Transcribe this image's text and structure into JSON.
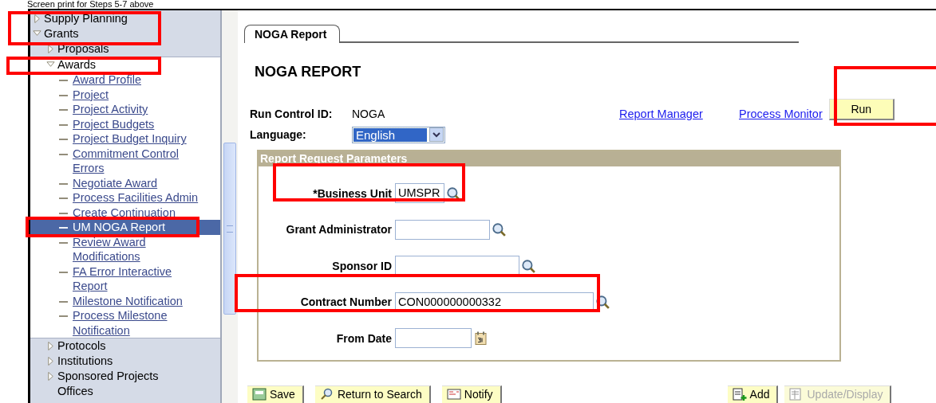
{
  "caption": "Screen print for Steps 5-7 above",
  "nav": [
    {
      "label": "Supply Planning",
      "expanded": false
    },
    {
      "label": "Grants",
      "expanded": true,
      "children": [
        {
          "label": "Proposals",
          "expanded": false
        },
        {
          "label": "Awards",
          "expanded": true,
          "children": [
            {
              "label": "Award Profile",
              "selected": false
            },
            {
              "label": "Project",
              "selected": false
            },
            {
              "label": "Project Activity",
              "selected": false
            },
            {
              "label": "Project Budgets",
              "selected": false
            },
            {
              "label": "Project Budget Inquiry",
              "selected": false
            },
            {
              "label": "Commitment Control Errors",
              "selected": false
            },
            {
              "label": "Negotiate Award",
              "selected": false
            },
            {
              "label": "Process Facilities Admin",
              "selected": false
            },
            {
              "label": "Create Continuation",
              "selected": false
            },
            {
              "label": "UM NOGA Report",
              "selected": true
            },
            {
              "label": "Review Award Modifications",
              "selected": false
            },
            {
              "label": "FA Error Interactive Report",
              "selected": false
            },
            {
              "label": "Milestone Notification",
              "selected": false
            },
            {
              "label": "Process Milestone Notification",
              "selected": false
            }
          ]
        },
        {
          "label": "Protocols",
          "expanded": false
        },
        {
          "label": "Institutions",
          "expanded": false
        },
        {
          "label": "Sponsored Projects Offices",
          "expanded": false
        }
      ]
    }
  ],
  "tabs": [
    {
      "label": "NOGA Report",
      "selected": true
    }
  ],
  "page_title": "NOGA REPORT",
  "run_control": {
    "label": "Run Control ID:",
    "value": "NOGA"
  },
  "links": [
    "Report Manager",
    "Process Monitor"
  ],
  "run_button": "Run",
  "language": {
    "label": "Language:",
    "value": "English"
  },
  "group": {
    "title": "Report Request Parameters",
    "fields": [
      {
        "label": "*Business Unit",
        "value": "UMSPR",
        "kind": "lookup"
      },
      {
        "label": "Grant Administrator",
        "kind": "lookup"
      },
      {
        "label": "Sponsor ID",
        "kind": "lookup"
      },
      {
        "label": "Contract Number",
        "value": "CON000000000332",
        "kind": "lookup"
      },
      {
        "label": "From Date",
        "kind": "date"
      }
    ]
  },
  "buttons_left": [
    {
      "label": "Save",
      "kind": "save",
      "disabled": false
    },
    {
      "label": "Return to Search",
      "kind": "search",
      "disabled": false
    },
    {
      "label": "Notify",
      "kind": "notify",
      "disabled": false
    }
  ],
  "buttons_right": [
    {
      "label": "Add",
      "kind": "add",
      "disabled": false
    },
    {
      "label": "Update/Display",
      "kind": "update",
      "disabled": true
    }
  ]
}
